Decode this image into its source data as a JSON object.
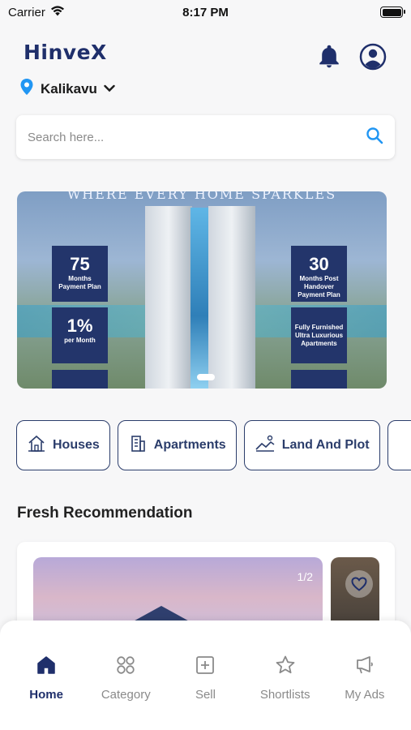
{
  "status_bar": {
    "carrier": "Carrier",
    "time": "8:17 PM"
  },
  "header": {
    "logo": "HinveX",
    "icons": [
      "bell-icon",
      "account-icon"
    ]
  },
  "location": {
    "name": "Kalikavu"
  },
  "search": {
    "placeholder": "Search here..."
  },
  "banner": {
    "tagline": "WHERE EVERY HOME SPARKLES",
    "stats": [
      {
        "value": "75",
        "caption": "Months Payment Plan"
      },
      {
        "value": "1%",
        "caption": "per Month"
      },
      {
        "value": "30",
        "caption": "Months Post Handover Payment Plan"
      },
      {
        "value": "",
        "caption": "Fully Furnished Ultra Luxurious Apartments"
      }
    ]
  },
  "categories": [
    {
      "label": "Houses",
      "icon": "house-icon"
    },
    {
      "label": "Apartments",
      "icon": "building-icon"
    },
    {
      "label": "Land And Plot",
      "icon": "land-icon"
    }
  ],
  "recommendations": {
    "title": "Fresh Recommendation",
    "image_counter": "1/2"
  },
  "tabs": [
    {
      "label": "Home",
      "icon": "home-icon",
      "active": true
    },
    {
      "label": "Category",
      "icon": "category-icon",
      "active": false
    },
    {
      "label": "Sell",
      "icon": "sell-icon",
      "active": false
    },
    {
      "label": "Shortlists",
      "icon": "star-icon",
      "active": false
    },
    {
      "label": "My Ads",
      "icon": "megaphone-icon",
      "active": false
    }
  ],
  "colors": {
    "primary": "#1f2f6b",
    "accent": "#2196f3",
    "location_pin": "#2196f3"
  }
}
